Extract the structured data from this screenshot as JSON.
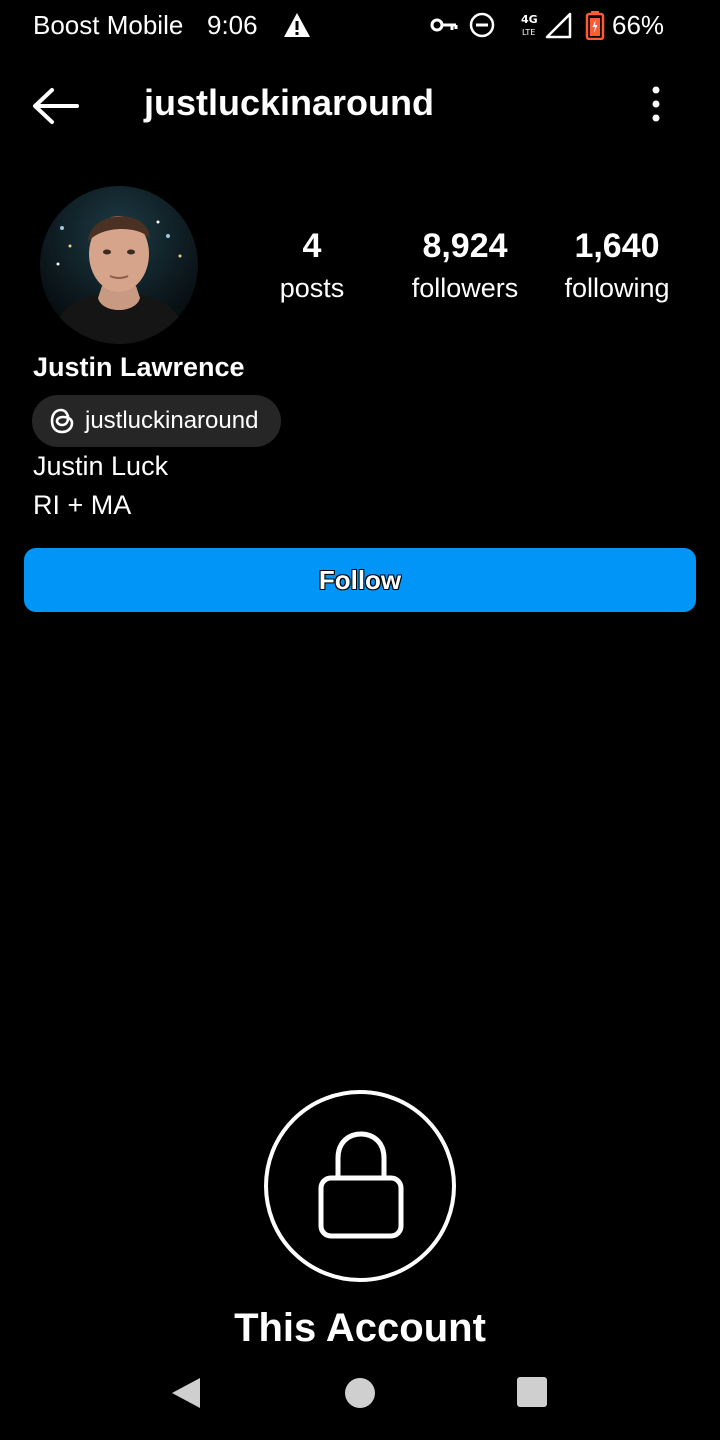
{
  "status_bar": {
    "carrier": "Boost Mobile",
    "time": "9:06",
    "network": "4G LTE",
    "battery": "66%",
    "battery_color": "#ff5a36",
    "icons": [
      "warning-icon",
      "vpn-key-icon",
      "do-not-disturb-icon",
      "signal-icon",
      "battery-icon"
    ]
  },
  "header": {
    "username": "justluckinaround",
    "back_icon": "arrow-left-icon",
    "menu_icon": "more-vertical-icon"
  },
  "profile": {
    "stats": [
      {
        "value": "4",
        "label": "posts"
      },
      {
        "value": "8,924",
        "label": "followers"
      },
      {
        "value": "1,640",
        "label": "following"
      }
    ],
    "full_name": "Justin Lawrence",
    "threads_handle": "justluckinaround",
    "bio": [
      "Justin Luck",
      "RI + MA"
    ]
  },
  "actions": {
    "follow_label": "Follow",
    "accent": "#0095f6"
  },
  "private_notice": {
    "title": "This Account",
    "icon": "lock-icon"
  },
  "nav_bar": {
    "icons": [
      "nav-back-icon",
      "nav-home-icon",
      "nav-recents-icon"
    ]
  }
}
